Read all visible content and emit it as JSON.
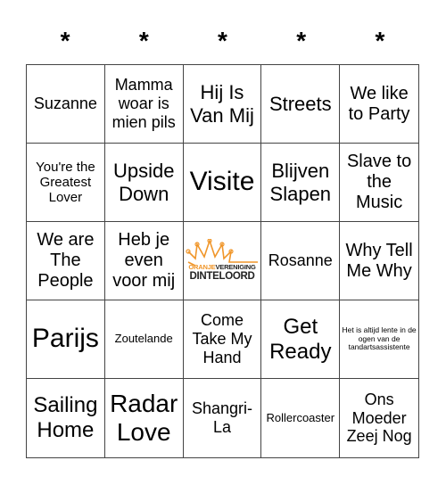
{
  "header": {
    "columns": [
      "*",
      "*",
      "*",
      "*",
      "*"
    ]
  },
  "board": {
    "cells": [
      "Suzanne",
      "Mamma woar is mien pils",
      "Hij Is Van Mij",
      "Streets",
      "We like to Party",
      "You're the Greatest Lover",
      "Upside Down",
      "Visite",
      "Blijven Slapen",
      "Slave to the Music",
      "We are The People",
      "Heb je even voor mij",
      "",
      "Rosanne",
      "Why Tell Me Why",
      "Parijs",
      "Zoutelande",
      "Come Take My Hand",
      "Get Ready",
      "Het is altijd lente in de ogen van de tandartsassistente",
      "Sailing Home",
      "Radar Love",
      "Shangri-La",
      "Rollercoaster",
      "Ons Moeder Zeej Nog"
    ],
    "free_space": {
      "logo_line1_part1": "ORANJE",
      "logo_line1_part2": "VERENIGING",
      "logo_line2": "DINTELOORD",
      "logo_icon": "crown-icon"
    }
  },
  "colors": {
    "accent": "#f0962a",
    "logo_text": "#222222",
    "grid_line": "#444444"
  }
}
